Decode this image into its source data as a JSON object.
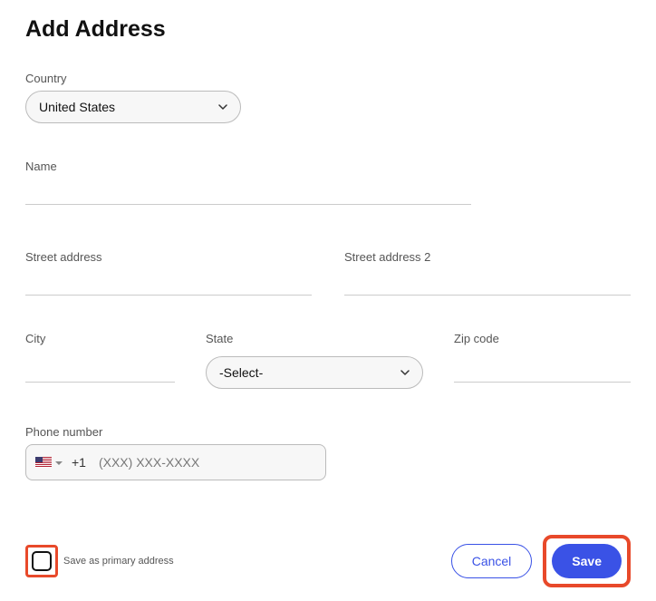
{
  "title": "Add Address",
  "fields": {
    "country": {
      "label": "Country",
      "value": "United States"
    },
    "name": {
      "label": "Name",
      "value": ""
    },
    "street1": {
      "label": "Street address",
      "value": ""
    },
    "street2": {
      "label": "Street address 2",
      "value": ""
    },
    "city": {
      "label": "City",
      "value": ""
    },
    "state": {
      "label": "State",
      "value": "-Select-"
    },
    "zip": {
      "label": "Zip code",
      "value": ""
    },
    "phone": {
      "label": "Phone number",
      "dial_code": "+1",
      "placeholder": "(XXX) XXX-XXXX",
      "value": ""
    }
  },
  "checkbox": {
    "label": "Save as primary address",
    "checked": false
  },
  "buttons": {
    "cancel": "Cancel",
    "save": "Save"
  }
}
